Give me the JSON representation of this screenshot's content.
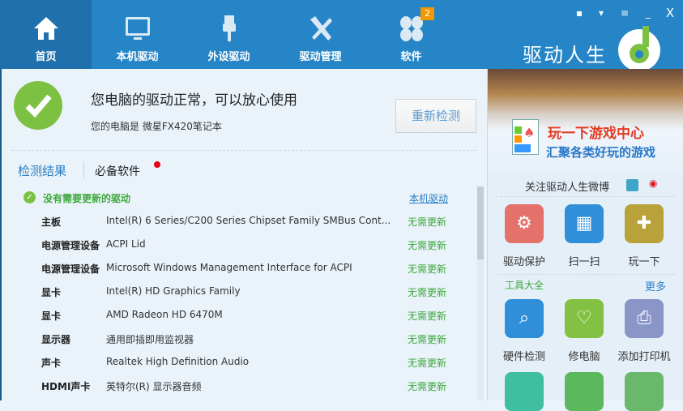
{
  "nav": {
    "tabs": [
      {
        "label": "首页",
        "icon": "home-icon"
      },
      {
        "label": "本机驱动",
        "icon": "monitor-icon"
      },
      {
        "label": "外设驱动",
        "icon": "usb-icon"
      },
      {
        "label": "驱动管理",
        "icon": "tools-icon"
      },
      {
        "label": "软件",
        "icon": "clover-icon",
        "badge": "2"
      }
    ],
    "window_buttons": [
      "message-icon",
      "skin-icon",
      "menu-icon",
      "minimize-icon",
      "close-icon"
    ],
    "brand": "驱动人生",
    "brand_logo": "6"
  },
  "status": {
    "title": "您电脑的驱动正常，可以放心使用",
    "subtitle": "您的电脑是 微星FX420笔记本",
    "recheck": "重新检测"
  },
  "subtabs": {
    "results": "检测结果",
    "software": "必备软件"
  },
  "summary": {
    "text": "没有需要更新的驱动",
    "link": "本机驱动"
  },
  "drivers": [
    {
      "category": "主板",
      "name": "Intel(R) 6 Series/C200 Series Chipset Family SMBus Cont...",
      "status": "无需更新"
    },
    {
      "category": "电源管理设备",
      "name": "ACPI Lid",
      "status": "无需更新"
    },
    {
      "category": "电源管理设备",
      "name": "Microsoft Windows Management Interface for ACPI",
      "status": "无需更新"
    },
    {
      "category": "显卡",
      "name": "Intel(R) HD Graphics Family",
      "status": "无需更新"
    },
    {
      "category": "显卡",
      "name": "AMD Radeon HD 6470M",
      "status": "无需更新"
    },
    {
      "category": "显示器",
      "name": "通用即插即用监视器",
      "status": "无需更新"
    },
    {
      "category": "声卡",
      "name": "Realtek High Definition Audio",
      "status": "无需更新"
    },
    {
      "category": "HDMI声卡",
      "name": "英特尔(R) 显示器音频",
      "status": "无需更新"
    }
  ],
  "sidebar": {
    "banner_title": "玩一下游戏中心",
    "banner_sub": "汇聚各类好玩的游戏",
    "weibo": "关注驱动人生微博",
    "quick": [
      {
        "label": "驱动保护",
        "color": "#e4716a"
      },
      {
        "label": "扫一扫",
        "color": "#2f8fd8"
      },
      {
        "label": "玩一下",
        "color": "#b9a23a"
      }
    ],
    "tools_title": "工具大全",
    "more": "更多",
    "tools": [
      {
        "label": "硬件检测",
        "color": "#2f8fd8"
      },
      {
        "label": "修电脑",
        "color": "#82c141"
      },
      {
        "label": "添加打印机",
        "color": "#8a95c8"
      }
    ],
    "tools2": [
      {
        "color": "#3fbfa0"
      },
      {
        "color": "#5cb85c"
      },
      {
        "color": "#6ab86a"
      }
    ]
  }
}
